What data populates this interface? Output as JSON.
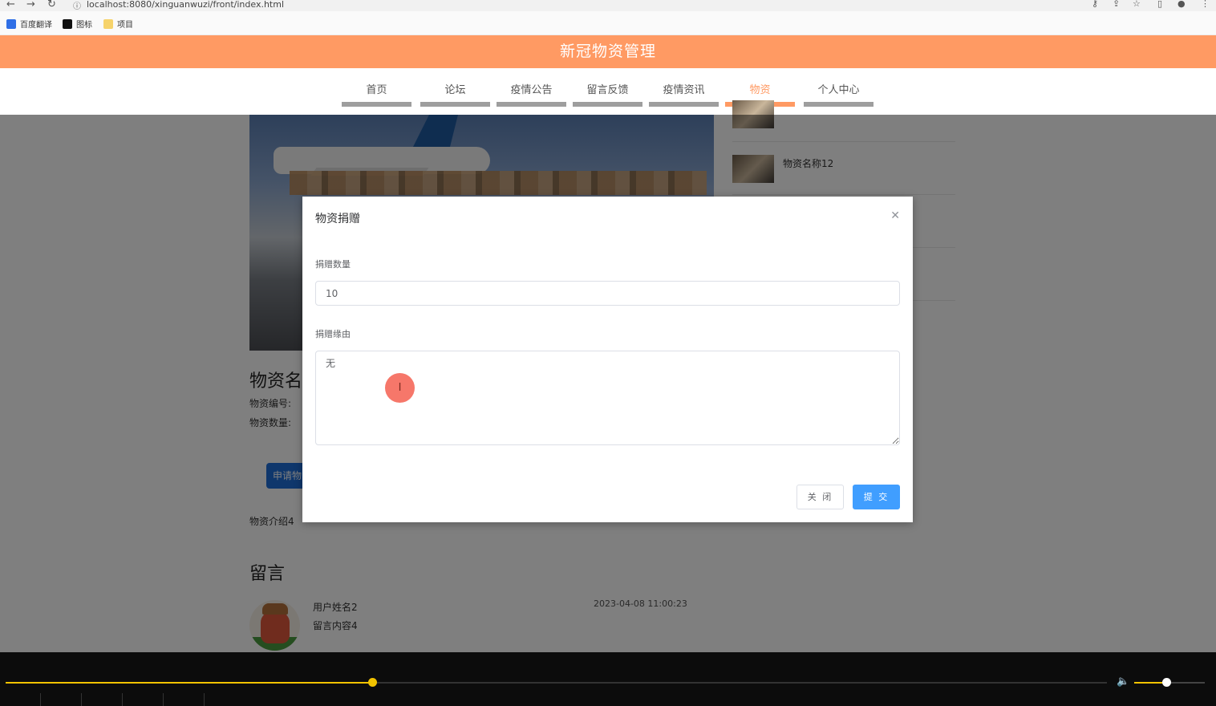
{
  "browser": {
    "url": "localhost:8080/xinguanwuzi/front/index.html",
    "bookmarks": [
      "百度翻译",
      "图标",
      "项目"
    ]
  },
  "site": {
    "title": "新冠物资管理",
    "nav": [
      "首页",
      "论坛",
      "疫情公告",
      "留言反馈",
      "疫情资讯",
      "物资",
      "个人中心"
    ],
    "active_nav": "物资"
  },
  "product": {
    "name": "物资名",
    "code_label": "物资编号:",
    "qty_label": "物资数量:",
    "apply_button": "申请物",
    "description": "物资介绍4"
  },
  "sidebar": {
    "items": [
      {
        "label": ""
      },
      {
        "label": "物资名称12"
      }
    ]
  },
  "comments": {
    "title": "留言",
    "items": [
      {
        "user": "用户姓名2",
        "content": "留言内容4",
        "time": "2023-04-08 11:00:23"
      }
    ]
  },
  "modal": {
    "title": "物资捐赠",
    "quantity_label": "捐赠数量",
    "quantity_value": "10",
    "reason_label": "捐赠缘由",
    "reason_value": "无",
    "close_button": "关 闭",
    "submit_button": "提 交"
  },
  "player": {
    "progress": 0.333,
    "volume": 0.45
  },
  "colors": {
    "header": "#ff9a63",
    "primary": "#409eff",
    "progress": "#f2c300"
  }
}
